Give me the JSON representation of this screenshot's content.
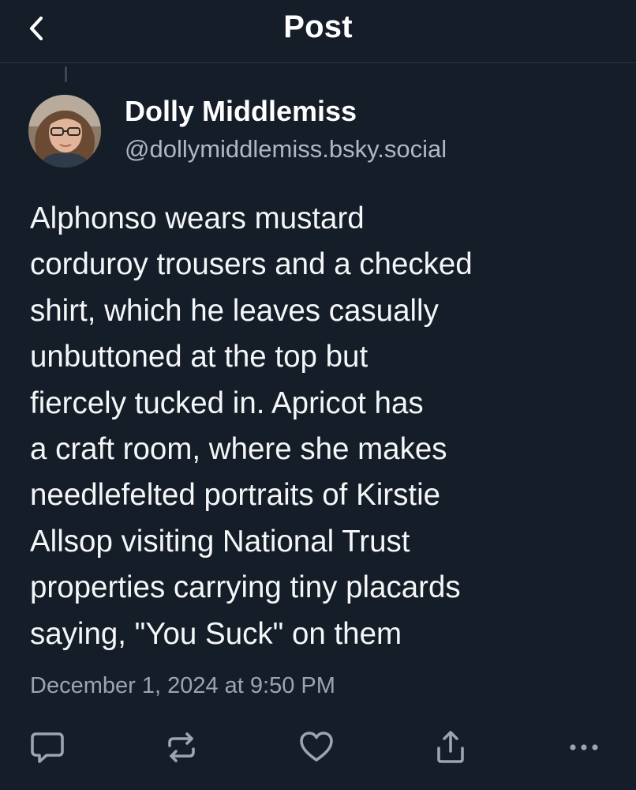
{
  "header": {
    "title": "Post",
    "back_icon": "chevron-left-icon"
  },
  "post": {
    "author": {
      "name": "Dolly Middlemiss",
      "handle": "@dollymiddlemiss.bsky.social"
    },
    "text": "Alphonso wears mustard\ncorduroy trousers and a checked\nshirt, which he leaves casually\nunbuttoned at the top but\nfiercely tucked in. Apricot has\na craft room, where she makes\nneedlefelted portraits of Kirstie\nAllsop visiting National Trust\nproperties carrying tiny placards\nsaying, \"You Suck\" on them",
    "timestamp": "December 1, 2024 at 9:50 PM"
  },
  "actions": [
    {
      "name": "reply",
      "icon": "speech-bubble-icon"
    },
    {
      "name": "repost",
      "icon": "repost-icon"
    },
    {
      "name": "like",
      "icon": "heart-icon"
    },
    {
      "name": "share",
      "icon": "share-icon"
    },
    {
      "name": "more",
      "icon": "ellipsis-icon"
    }
  ],
  "colors": {
    "background": "#151d28",
    "text_primary": "#f4f6f8",
    "text_secondary": "#9aa5b4",
    "icon": "#9aa5b4"
  }
}
